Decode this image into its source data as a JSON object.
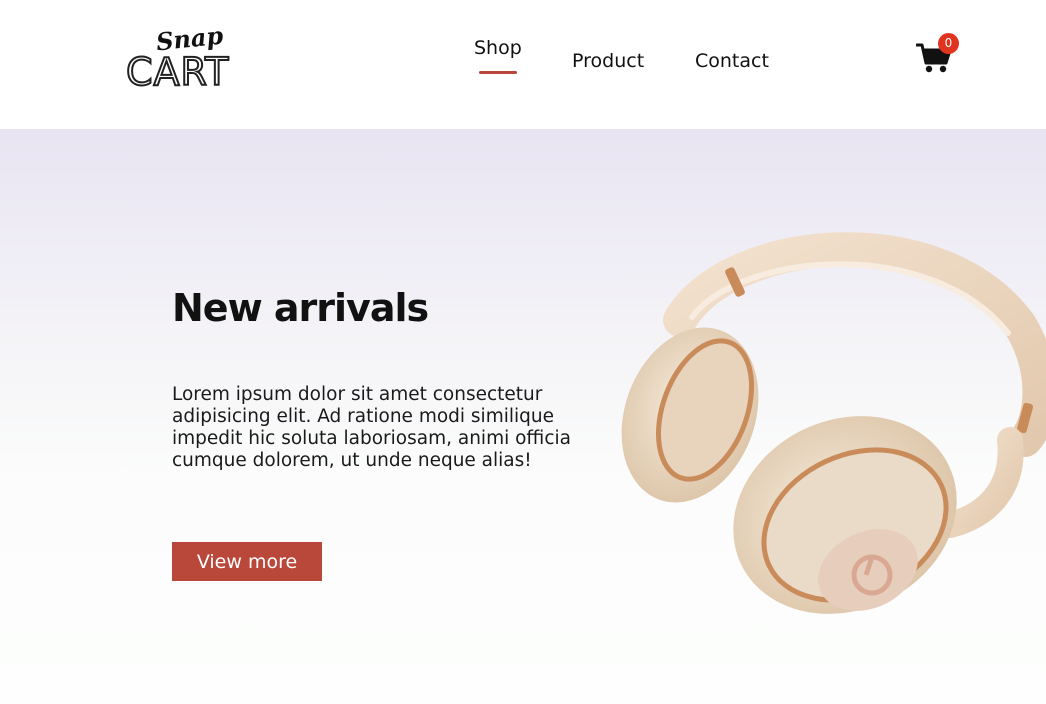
{
  "brand": {
    "script": "Snap",
    "name": "CART"
  },
  "nav": [
    {
      "label": "Shop",
      "active": true
    },
    {
      "label": "Product",
      "active": false
    },
    {
      "label": "Contact",
      "active": false
    }
  ],
  "cart": {
    "count": "0",
    "icon": "cart-icon"
  },
  "hero": {
    "title": "New arrivals",
    "description": "Lorem ipsum dolor sit amet consectetur adipisicing elit. Ad ratione modi similique impedit hic soluta laboriosam, animi officia cumque dolorem, ut unde neque alias!",
    "button_label": "View more",
    "image": "headphones-image"
  },
  "colors": {
    "accent": "#b9473a",
    "badge": "#e0341f",
    "hero_top": "#e8e4f2",
    "headphone": "#ead9c6"
  }
}
